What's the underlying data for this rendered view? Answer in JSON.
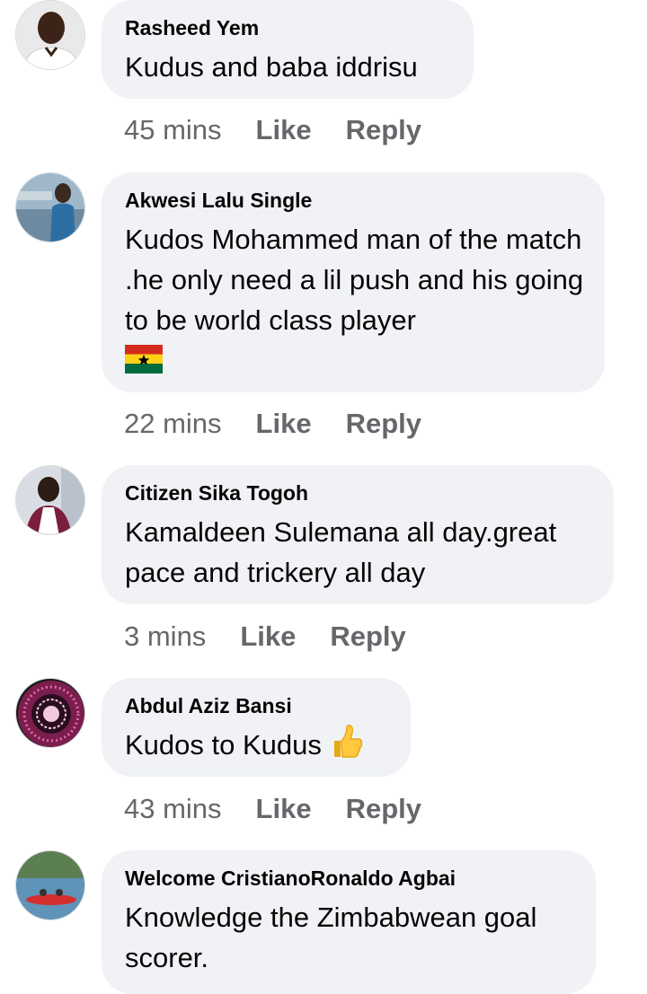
{
  "comments": [
    {
      "author": "Rasheed Yem",
      "text": "Kudus and baba iddrisu",
      "time": "45 mins",
      "like_label": "Like",
      "reply_label": "Reply"
    },
    {
      "author": "Akwesi Lalu Single",
      "text": "Kudos Mohammed man of the match .he only need a lil push and his  going to be world class player",
      "emoji": "ghana-flag",
      "time": "22 mins",
      "like_label": "Like",
      "reply_label": "Reply"
    },
    {
      "author": "Citizen Sika Togoh",
      "text": "Kamaldeen Sulemana all day.great pace and trickery all day",
      "time": "3 mins",
      "like_label": "Like",
      "reply_label": "Reply"
    },
    {
      "author": "Abdul Aziz Bansi",
      "text": "Kudos to Kudus",
      "emoji": "thumbs-up",
      "time": "43 mins",
      "like_label": "Like",
      "reply_label": "Reply"
    },
    {
      "author": "Welcome CristianoRonaldo Agbai",
      "text": "Knowledge the Zimbabwean goal scorer."
    }
  ],
  "colors": {
    "bubble": "#f0f2f5",
    "meta": "#65676b",
    "text": "#050505"
  }
}
